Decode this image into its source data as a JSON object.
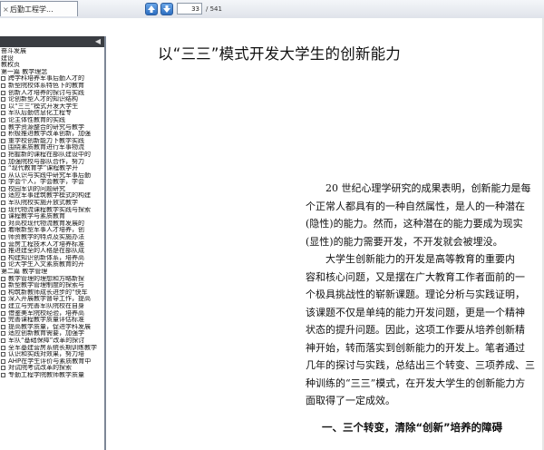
{
  "toolbar": {
    "tab_label": "后勤工程学...",
    "current_page": "33",
    "total_pages": "/ 541"
  },
  "sidebar": {
    "items": [
      {
        "type": "sec",
        "label": "奋斗发展"
      },
      {
        "type": "sec",
        "label": "建设"
      },
      {
        "type": "sec",
        "label": "教权页"
      },
      {
        "type": "sec",
        "label": "第一篇 教学理念"
      },
      {
        "type": "item",
        "label": "跨学科培养军事后勤人才的"
      },
      {
        "type": "item",
        "label": "新型院校体系特色下的教育"
      },
      {
        "type": "item",
        "label": "创新人才培养的探讨与实践"
      },
      {
        "type": "item",
        "label": "论创新型人才的知识结构"
      },
      {
        "type": "item",
        "label": "以“三三”模式开发大学生"
      },
      {
        "type": "item",
        "label": "军队后勤信息化工程专"
      },
      {
        "type": "item",
        "label": "论主体性教育的实践"
      },
      {
        "type": "item",
        "label": "教学资源整合的研究与教学"
      },
      {
        "type": "item",
        "label": "积极推进教学改革创新，加强"
      },
      {
        "type": "item",
        "label": "重学校创新能力下教学实践"
      },
      {
        "type": "item",
        "label": "围绕素质教育进行军事物流"
      },
      {
        "type": "item",
        "label": "把握新的课程在部队建设中的"
      },
      {
        "type": "item",
        "label": "加强院校与部队合作，努力"
      },
      {
        "type": "item",
        "label": "“现代教育学”课程教学开"
      },
      {
        "type": "item",
        "label": "从认识与实践中研究军事后勤"
      },
      {
        "type": "item",
        "label": "学会个人，学会教学，学会"
      },
      {
        "type": "item",
        "label": "校园军训的问题研究"
      },
      {
        "type": "item",
        "label": "适应军事建筑教学模式的构建"
      },
      {
        "type": "item",
        "label": "军队院校实施开放式教学"
      },
      {
        "type": "item",
        "label": "现代物流课程教学实践与探索"
      },
      {
        "type": "item",
        "label": "课程教学与素质教育"
      },
      {
        "type": "item",
        "label": "对高校现代物流教育发展的"
      },
      {
        "type": "item",
        "label": "着眼新型军事人才培养，创"
      },
      {
        "type": "item",
        "label": "师资教学的特点及实施办法"
      },
      {
        "type": "item",
        "label": "营房工程技术人才培养标准"
      },
      {
        "type": "item",
        "label": "推进建全的人格是在部队成"
      },
      {
        "type": "item",
        "label": "构建知识创新体系，培养高"
      },
      {
        "type": "item",
        "label": "论大学生入文素质教育的开"
      },
      {
        "type": "sec",
        "label": "第二篇 教学管理"
      },
      {
        "type": "item",
        "label": "教学管理的理想和方略新探"
      },
      {
        "type": "item",
        "label": "新型教学管理制度的探索与"
      },
      {
        "type": "item",
        "label": "构筑新教师成长进步的“快车"
      },
      {
        "type": "item",
        "label": "深入开展教学督导工作，提高"
      },
      {
        "type": "item",
        "label": "建立与完善军队院校在自身"
      },
      {
        "type": "item",
        "label": "借鉴美军院校经验，培养高"
      },
      {
        "type": "item",
        "label": "完善课程教学质量评估标准"
      },
      {
        "type": "item",
        "label": "提高教学质量，促进学科发展"
      },
      {
        "type": "item",
        "label": "适应创新教育需要，加强学"
      },
      {
        "type": "item",
        "label": "军队“基础保障”改革的探讨"
      },
      {
        "type": "item",
        "label": "全军基建营房系统长期训练教学"
      },
      {
        "type": "item",
        "label": "认识和实践对效果，努力培"
      },
      {
        "type": "item",
        "label": "AHP在学生评价与素质教育中"
      },
      {
        "type": "item",
        "label": "对试院考试改革的探索"
      },
      {
        "type": "item",
        "label": "专勤工程学院教师教学质量"
      }
    ]
  },
  "document": {
    "title": "以“三三”模式开发大学生的创新能力",
    "para1": [
      "20 世纪心理学研究的成果表明，创新能力是每",
      "个正常人都具有的一种自然属性，是人的一种潜在",
      "(隐性)的能力。然而，这种潜在的能力要成为现实",
      "(显性)的能力需要开发，不开发就会被埋没。"
    ],
    "para2": [
      "大学生创新能力的开发是高等教育的重要内",
      "容和核心问题，又是摆在广大教育工作者面前的一",
      "个极具挑战性的崭新课题。理论分析与实践证明，",
      "该课题不仅是单纯的能力开发问题，更是一个精神",
      "状态的提升问题。因此，这项工作要从培养创新精",
      "神开始，转而落实到创新能力的开发上。笔者通过",
      "几年的探讨与实践，总结出三个转变、三项养成、三",
      "种训练的“三三”模式，在开发大学生的创新能力方",
      "面取得了一定成效。"
    ],
    "section_heading": "一、三个转变，清除“创新”培养的障碍"
  },
  "colors": {
    "sidebar_header": "#3a3d42",
    "nav_button": "#2e6fc1",
    "toolbar_bg": "#dfe3ea"
  },
  "icons": {
    "prev": "arrow-up-icon",
    "next": "arrow-down-icon",
    "collapse": "chevron-left-icon"
  }
}
